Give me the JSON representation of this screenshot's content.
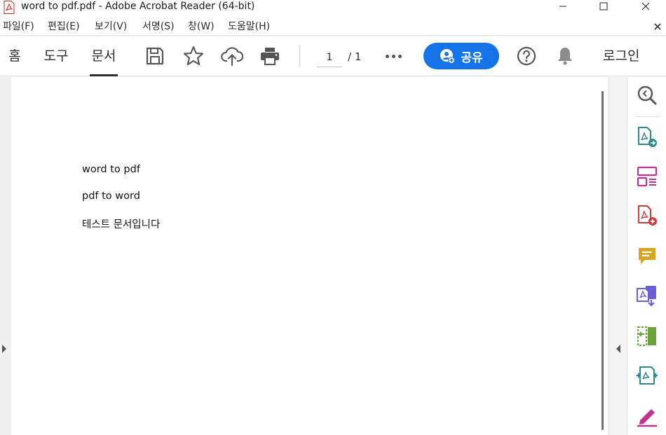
{
  "window": {
    "title": "word to pdf.pdf - Adobe Acrobat Reader (64-bit)"
  },
  "menu": {
    "items": [
      "파일(F)",
      "편집(E)",
      "보기(V)",
      "서명(S)",
      "창(W)",
      "도움말(H)"
    ]
  },
  "toolbar": {
    "tabs": [
      "홈",
      "도구",
      "문서"
    ],
    "active_tab": "문서",
    "current_page": "1",
    "total_pages": "/ 1",
    "share_label": "공유",
    "login_label": "로그인",
    "icons": [
      "save-icon",
      "star-icon",
      "cloud-upload-icon",
      "print-icon",
      "more-icon",
      "help-icon",
      "bell-icon"
    ]
  },
  "document": {
    "lines": [
      "word to pdf",
      "pdf to word",
      "테스트 문서입니다"
    ]
  },
  "tools_panel": {
    "icons": [
      "zoom-search-icon",
      "export-pdf-icon",
      "organize-pages-icon",
      "create-pdf-icon",
      "comment-icon",
      "combine-files-icon",
      "edit-pdf-icon",
      "compress-pdf-icon",
      "fill-sign-icon"
    ]
  },
  "colors": {
    "share_button": "#1473e6",
    "teal": "#2d8a8a",
    "magenta": "#c2338f",
    "red": "#d43b3b",
    "yellow": "#d9a521",
    "purple": "#6b5fd6",
    "green": "#6aa33d"
  }
}
